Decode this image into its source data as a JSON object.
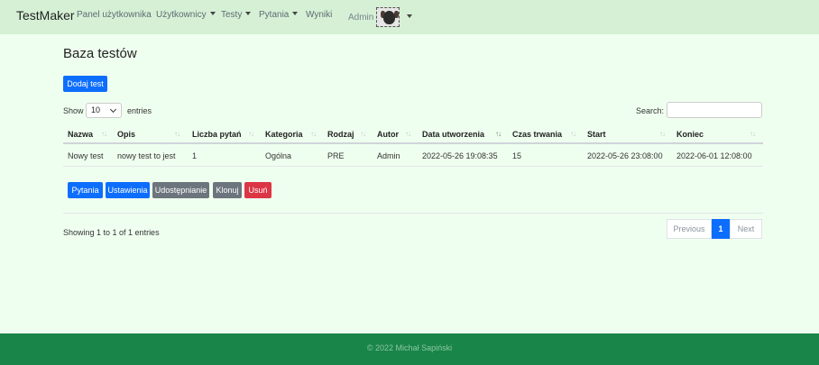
{
  "nav": {
    "brand": "TestMaker",
    "items": [
      {
        "label": "Panel użytkownika",
        "dropdown": false
      },
      {
        "label": "Użytkownicy",
        "dropdown": true
      },
      {
        "label": "Testy",
        "dropdown": true
      },
      {
        "label": "Pytania",
        "dropdown": true
      },
      {
        "label": "Wyniki",
        "dropdown": false
      }
    ],
    "user": "Admin",
    "avatar_icon": "dog-avatar"
  },
  "page": {
    "title": "Baza testów",
    "add_button": "Dodaj test"
  },
  "table_controls": {
    "show_label": "Show",
    "page_length": "10",
    "entries_label": "entries",
    "search_label": "Search:",
    "search_value": ""
  },
  "table": {
    "columns": [
      "Nazwa",
      "Opis",
      "Liczba pytań",
      "Kategoria",
      "Rodzaj",
      "Autor",
      "Data utworzenia",
      "Czas trwania",
      "Start",
      "Koniec"
    ],
    "rows": [
      [
        "Nowy test",
        "nowy test to jest",
        "1",
        "Ogólna",
        "PRE",
        "Admin",
        "2022-05-26 19:08:35",
        "15",
        "2022-05-26 23:08:00",
        "2022-06-01 12:08:00"
      ]
    ],
    "sorted_column": "Data utworzenia"
  },
  "actions": [
    "Pytania",
    "Ustawienia",
    "Udostępnianie",
    "Klonuj",
    "Usuń"
  ],
  "pagination": {
    "info": "Showing 1 to 1 of 1 entries",
    "previous": "Previous",
    "current": "1",
    "next": "Next"
  },
  "footer": {
    "text": "© 2022 Michał Sapiński"
  },
  "colors": {
    "primary": "#0d6efd",
    "secondary": "#6c757d",
    "danger": "#dc3545",
    "footer": "#198548",
    "navbar": "#d5f0d5",
    "background": "#efffef"
  }
}
